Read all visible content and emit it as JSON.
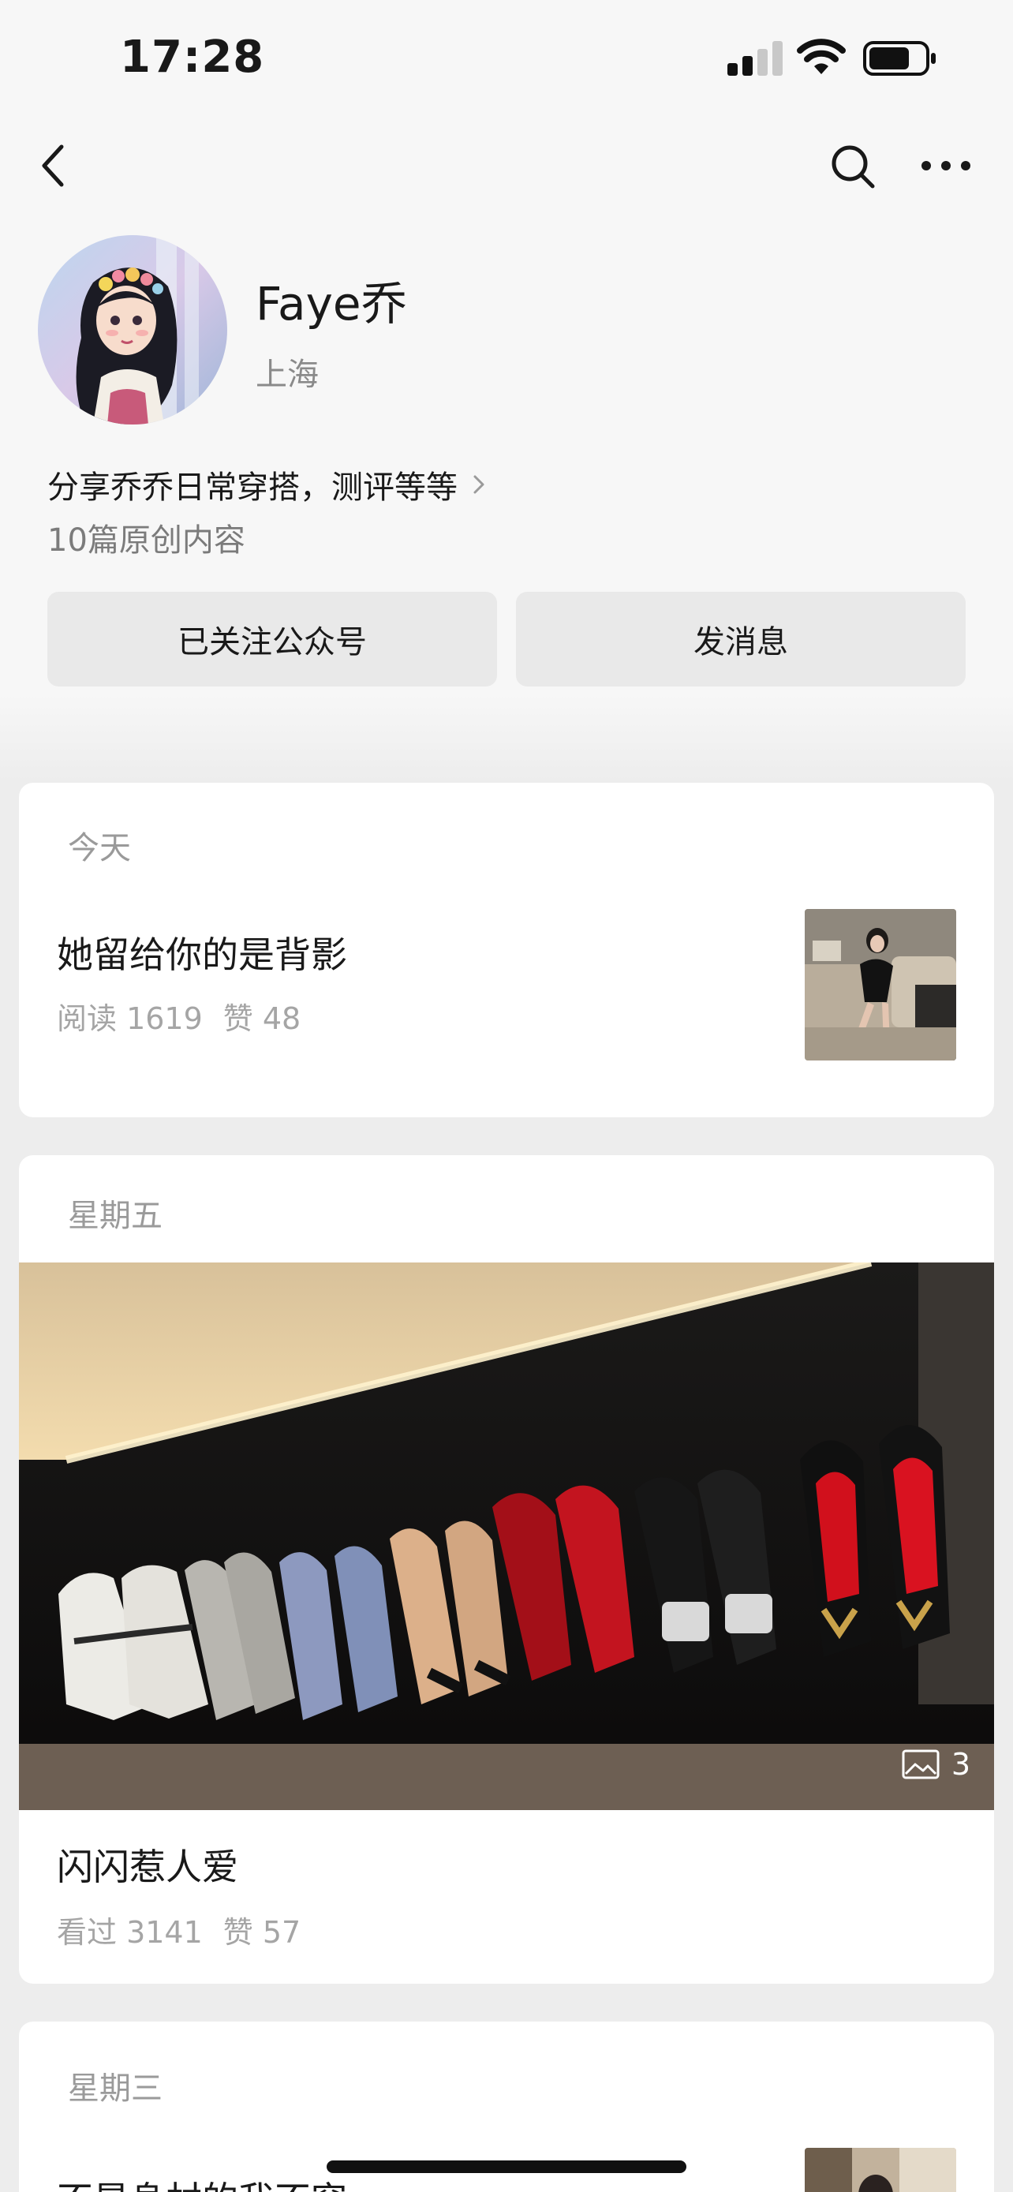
{
  "status_bar": {
    "time": "17:28"
  },
  "profile": {
    "name": "Faye乔",
    "location": "上海",
    "bio": "分享乔乔日常穿搭，测评等等",
    "article_count": "10篇原创内容"
  },
  "buttons": {
    "follow": "已关注公众号",
    "message": "发消息"
  },
  "articles": [
    {
      "date": "今天",
      "title": "她留给你的是背影",
      "reads": "阅读 1619",
      "likes": "赞 48"
    },
    {
      "date": "星期五",
      "title": "闪闪惹人爱",
      "reads": "看过 3141",
      "likes": "赞 57",
      "photo_count": "3"
    },
    {
      "date": "星期三",
      "title": "不是身材的我不穿"
    }
  ],
  "colors": {
    "page_background": "#ededed",
    "header_background": "#f7f7f7",
    "button_background": "#e9e9e9",
    "secondary_text": "#9a9a9a"
  },
  "icons": [
    "back-icon",
    "search-icon",
    "more-icon",
    "chevron-right-icon",
    "image-gallery-icon"
  ]
}
